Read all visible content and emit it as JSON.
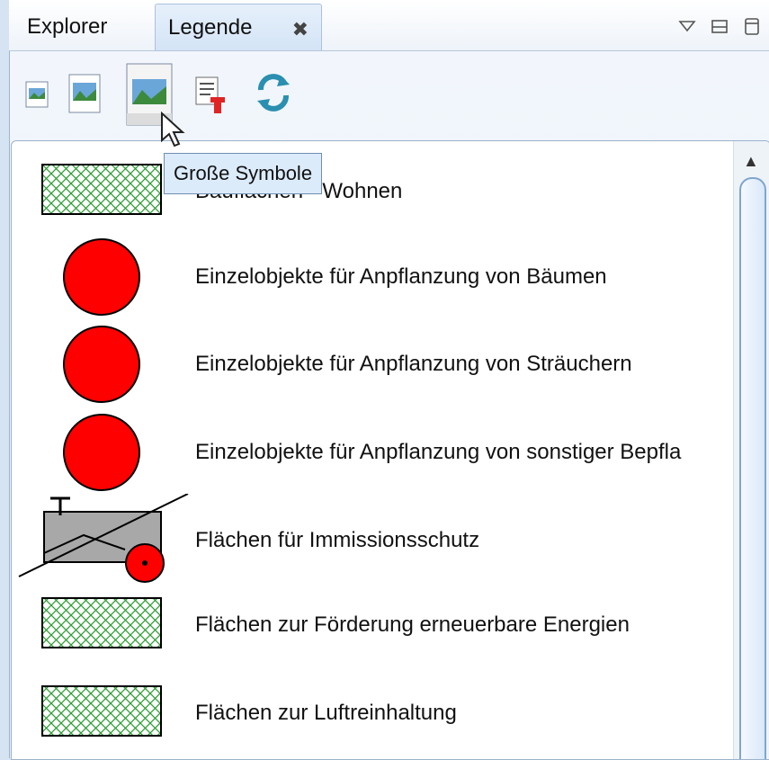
{
  "tabs": {
    "explorer": "Explorer",
    "legende": "Legende"
  },
  "toolbar": {
    "buttons": [
      "small-symbols-icon",
      "medium-symbols-icon",
      "large-symbols-icon",
      "export-legend-icon",
      "refresh-icon"
    ]
  },
  "tooltip": "Große Symbole",
  "legend": {
    "items": [
      {
        "label": "Bauflächen - Wohnen",
        "symbol": "green-hatch"
      },
      {
        "label": "Einzelobjekte für Anpflanzung von Bäumen",
        "symbol": "red-circle"
      },
      {
        "label": "Einzelobjekte für Anpflanzung von Sträuchern",
        "symbol": "red-circle"
      },
      {
        "label": "Einzelobjekte für Anpflanzung von sonstiger Bepfla",
        "symbol": "red-circle"
      },
      {
        "label": "Flächen für Immissionsschutz",
        "symbol": "immission-symbol"
      },
      {
        "label": "Flächen zur Förderung erneuerbare Energien",
        "symbol": "green-hatch"
      },
      {
        "label": "Flächen zur Luftreinhaltung",
        "symbol": "green-hatch"
      }
    ]
  },
  "colors": {
    "hatch_green": "#2f9e35",
    "symbol_red": "#ff0000",
    "gray_fill": "#a8a8a8"
  }
}
